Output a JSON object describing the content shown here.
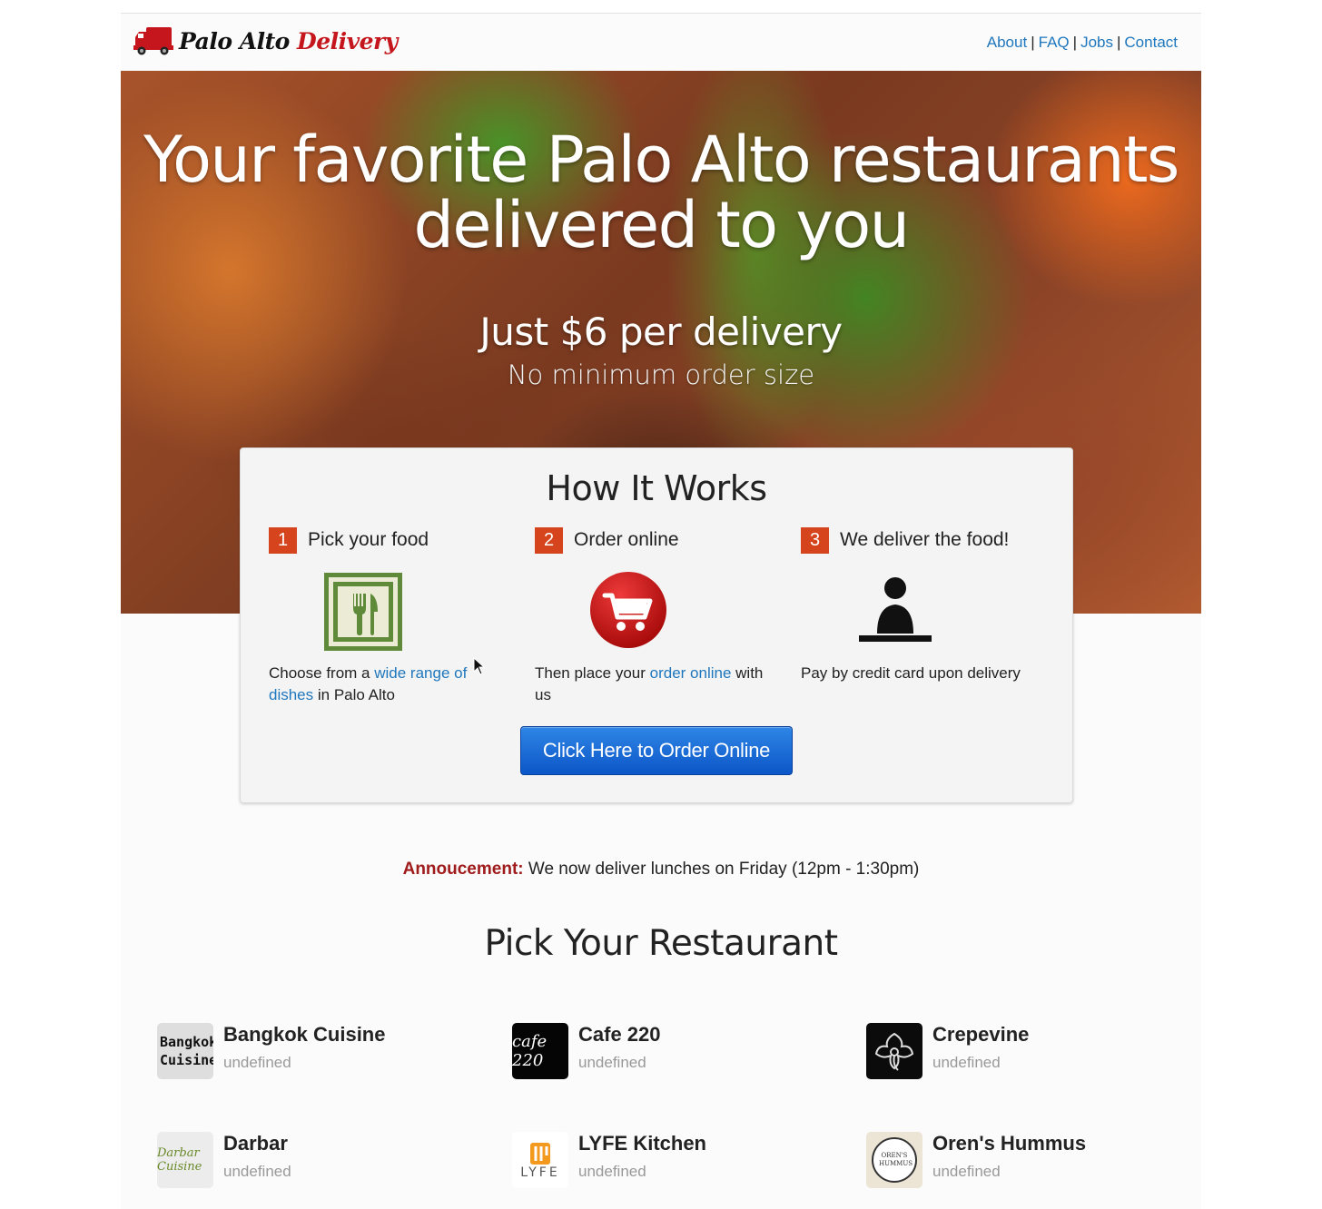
{
  "header": {
    "logo_part1": "Palo Alto",
    "logo_part2": "Delivery",
    "nav": [
      "About",
      "FAQ",
      "Jobs",
      "Contact"
    ],
    "nav_separator": "|"
  },
  "hero": {
    "title_line1": "Your favorite Palo Alto restaurants",
    "title_line2": "delivered to you",
    "price": "Just $6 per delivery",
    "subtitle": "No minimum order size"
  },
  "how_it_works": {
    "title": "How It Works",
    "steps": [
      {
        "number": "1",
        "title": "Pick your food",
        "desc_pre": "Choose from a ",
        "desc_link": "wide range of dishes",
        "desc_post": " in Palo Alto",
        "icon": "fork-knife-icon"
      },
      {
        "number": "2",
        "title": "Order online",
        "desc_pre": "Then place your ",
        "desc_link": "order online",
        "desc_post": " with us",
        "icon": "shopping-cart-icon"
      },
      {
        "number": "3",
        "title": "We deliver the food!",
        "desc_pre": "Pay by credit card upon delivery",
        "desc_link": "",
        "desc_post": "",
        "icon": "person-icon"
      }
    ],
    "button_label": "Click Here to Order Online"
  },
  "announcement": {
    "label": "Annoucement:",
    "text": " We now deliver lunches on Friday (12pm - 1:30pm)"
  },
  "restaurants": {
    "title": "Pick Your Restaurant",
    "items": [
      {
        "name": "Bangkok Cuisine",
        "subtitle": "undefined",
        "logo_text": "Bangkok Cuisine"
      },
      {
        "name": "Cafe 220",
        "subtitle": "undefined",
        "logo_text": "cafe 220"
      },
      {
        "name": "Crepevine",
        "subtitle": "undefined",
        "logo_text": ""
      },
      {
        "name": "Darbar",
        "subtitle": "undefined",
        "logo_text": "Darbar Cuisine"
      },
      {
        "name": "LYFE Kitchen",
        "subtitle": "undefined",
        "logo_text": "LYFE"
      },
      {
        "name": "Oren's Hummus",
        "subtitle": "undefined",
        "logo_text": "OREN'S HUMMUS"
      }
    ]
  },
  "colors": {
    "link": "#1f77bd",
    "step_badge": "#d5441c",
    "button": "#0b56c8",
    "logo_red": "#c4161c",
    "announcement_label": "#a01b1b"
  }
}
